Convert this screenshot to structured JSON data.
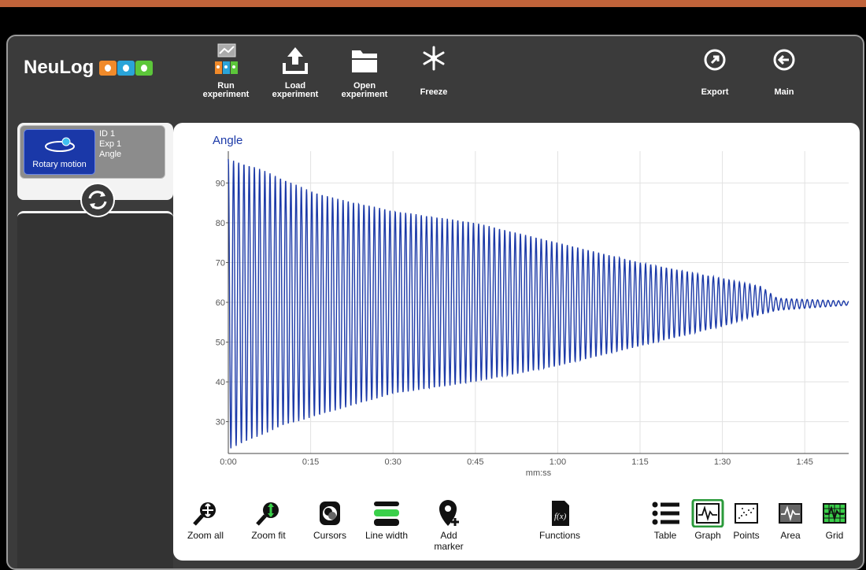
{
  "app": {
    "logo_text": "NeuLog"
  },
  "toolbar": {
    "run_label": "Run experiment",
    "load_label": "Load experiment",
    "open_label": "Open experiment",
    "freeze_label": "Freeze",
    "export_label": "Export",
    "main_label": "Main"
  },
  "sensor": {
    "name": "Rotary motion",
    "id": "ID 1",
    "exp": "Exp 1",
    "measure": "Angle"
  },
  "bottom_toolbar": {
    "zoom_all": "Zoom all",
    "zoom_fit": "Zoom fit",
    "cursors": "Cursors",
    "line_width": "Line width",
    "add_marker": "Add marker",
    "functions": "Functions",
    "table": "Table",
    "graph": "Graph",
    "points": "Points",
    "area": "Area",
    "grid": "Grid"
  },
  "colors": {
    "series": "#1c3aa8",
    "sensor_blue": "#1a38a8",
    "active_green": "#2a9a3a"
  },
  "chart_data": {
    "type": "line",
    "title": "Angle",
    "xlabel": "mm:ss",
    "ylabel": "",
    "x_ticks": [
      "0:00",
      "0:15",
      "0:30",
      "0:45",
      "1:00",
      "1:15",
      "1:30",
      "1:45"
    ],
    "y_ticks": [
      30,
      40,
      50,
      60,
      70,
      80,
      90
    ],
    "xlim_seconds": [
      0,
      113
    ],
    "ylim": [
      22,
      98
    ],
    "grid": true,
    "series": [
      {
        "description_points": [
          {
            "t": 0,
            "max": 96,
            "min": 23
          },
          {
            "t": 5,
            "max": 94,
            "min": 26
          },
          {
            "t": 10,
            "max": 91,
            "min": 29
          },
          {
            "t": 15,
            "max": 88,
            "min": 31
          },
          {
            "t": 20,
            "max": 86,
            "min": 33
          },
          {
            "t": 30,
            "max": 83,
            "min": 37
          },
          {
            "t": 45,
            "max": 80,
            "min": 40
          },
          {
            "t": 60,
            "max": 75,
            "min": 44
          },
          {
            "t": 75,
            "max": 70,
            "min": 49
          },
          {
            "t": 90,
            "max": 66,
            "min": 54
          },
          {
            "t": 97,
            "max": 64,
            "min": 57
          },
          {
            "t": 100,
            "max": 61,
            "min": 58
          },
          {
            "t": 113,
            "max": 60.3,
            "min": 59.3
          }
        ],
        "period_seconds": 0.95,
        "center": 60
      }
    ]
  }
}
